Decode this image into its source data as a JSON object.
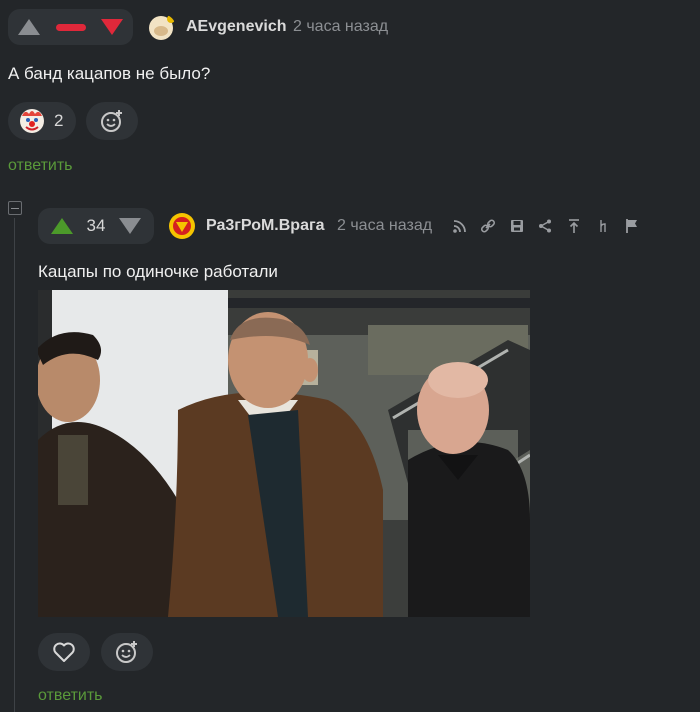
{
  "comment1": {
    "username": "AEvgenevich",
    "timestamp": "2 часа назад",
    "text": "А банд кацапов не было?",
    "reaction_emoji": "clown-face",
    "reaction_count": "2",
    "reply_label": "ответить"
  },
  "comment2": {
    "rating": "34",
    "username": "Ра3гРоМ.Врага",
    "timestamp": "2 часа назад",
    "text": "Кацапы по одиночке работали",
    "reply_label": "ответить"
  },
  "colors": {
    "background": "#232629",
    "pill": "#2f3337",
    "upvote_green": "#4c9a2a",
    "downvote_red": "#e0283a",
    "reply_green": "#5a9a3a",
    "muted": "#8c8f93"
  },
  "icons": [
    "rss-icon",
    "link-icon",
    "save-icon",
    "share-icon",
    "arrow-up-icon",
    "branch-icon",
    "flag-icon",
    "heart-icon",
    "add-reaction-icon",
    "collapse-icon"
  ]
}
